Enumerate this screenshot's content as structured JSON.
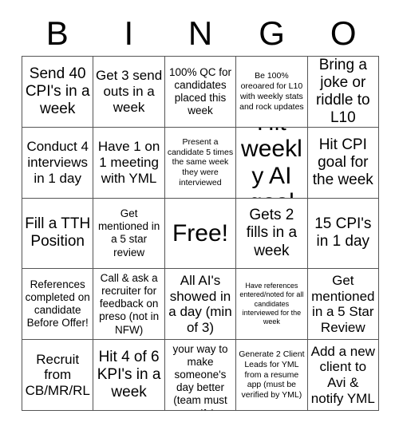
{
  "card": {
    "title": "BINGO",
    "header_letters": [
      "B",
      "I",
      "N",
      "G",
      "O"
    ],
    "rows": 5,
    "columns": 5,
    "free_space_label": "Free!",
    "free_space_position": "row3-col3",
    "colors": {
      "background": "#ffffff",
      "text": "#000000",
      "grid_line": "#555555"
    },
    "cells": [
      [
        {
          "text": "Send 40 CPI's in a week",
          "size": "lg"
        },
        {
          "text": "Get 3 send outs in a week",
          "size": "md"
        },
        {
          "text": "100% QC for candidates placed this week",
          "size": "sm"
        },
        {
          "text": "Be 100% oreoared for L10 with weekly stats and rock updates",
          "size": "xs"
        },
        {
          "text": "Bring a joke or riddle to L10",
          "size": "lg"
        }
      ],
      [
        {
          "text": "Conduct 4 interviews in 1 day",
          "size": "md"
        },
        {
          "text": "Have 1 on 1 meeting with YML",
          "size": "md"
        },
        {
          "text": "Present a candidate 5 times the same week they were interviewed",
          "size": "xs"
        },
        {
          "text": "Hit weekly AI goal",
          "size": "xl"
        },
        {
          "text": "Hit CPI goal for the week",
          "size": "lg"
        }
      ],
      [
        {
          "text": "Fill a TTH Position",
          "size": "lg"
        },
        {
          "text": "Get mentioned in a 5 star review",
          "size": "sm"
        },
        {
          "text": "Free!",
          "size": "xl",
          "is_free": true
        },
        {
          "text": "Gets 2 fills in a week",
          "size": "lg"
        },
        {
          "text": "15 CPI's in 1 day",
          "size": "lg"
        }
      ],
      [
        {
          "text": "References completed on candidate Before Offer!",
          "size": "sm"
        },
        {
          "text": "Call & ask a recruiter for feedback on preso (not in NFW)",
          "size": "sm"
        },
        {
          "text": "All AI's showed in a day (min of 3)",
          "size": "md"
        },
        {
          "text": "Have references entered/noted for all candidates interviewed for the week",
          "size": "xxs"
        },
        {
          "text": "Get mentioned in a 5 Star Review",
          "size": "md"
        }
      ],
      [
        {
          "text": "Recruit from CB/MR/RL",
          "size": "md"
        },
        {
          "text": "Hit 4 of 6 KPI's in a week",
          "size": "lg"
        },
        {
          "text": "Go out of your way to make someone's day better (team must verify)",
          "size": "sm"
        },
        {
          "text": "Generate 2 Client Leads for YML from a resume app (must be verified by YML)",
          "size": "xs"
        },
        {
          "text": "Add a new client to Avi & notify YML",
          "size": "md"
        }
      ]
    ]
  }
}
